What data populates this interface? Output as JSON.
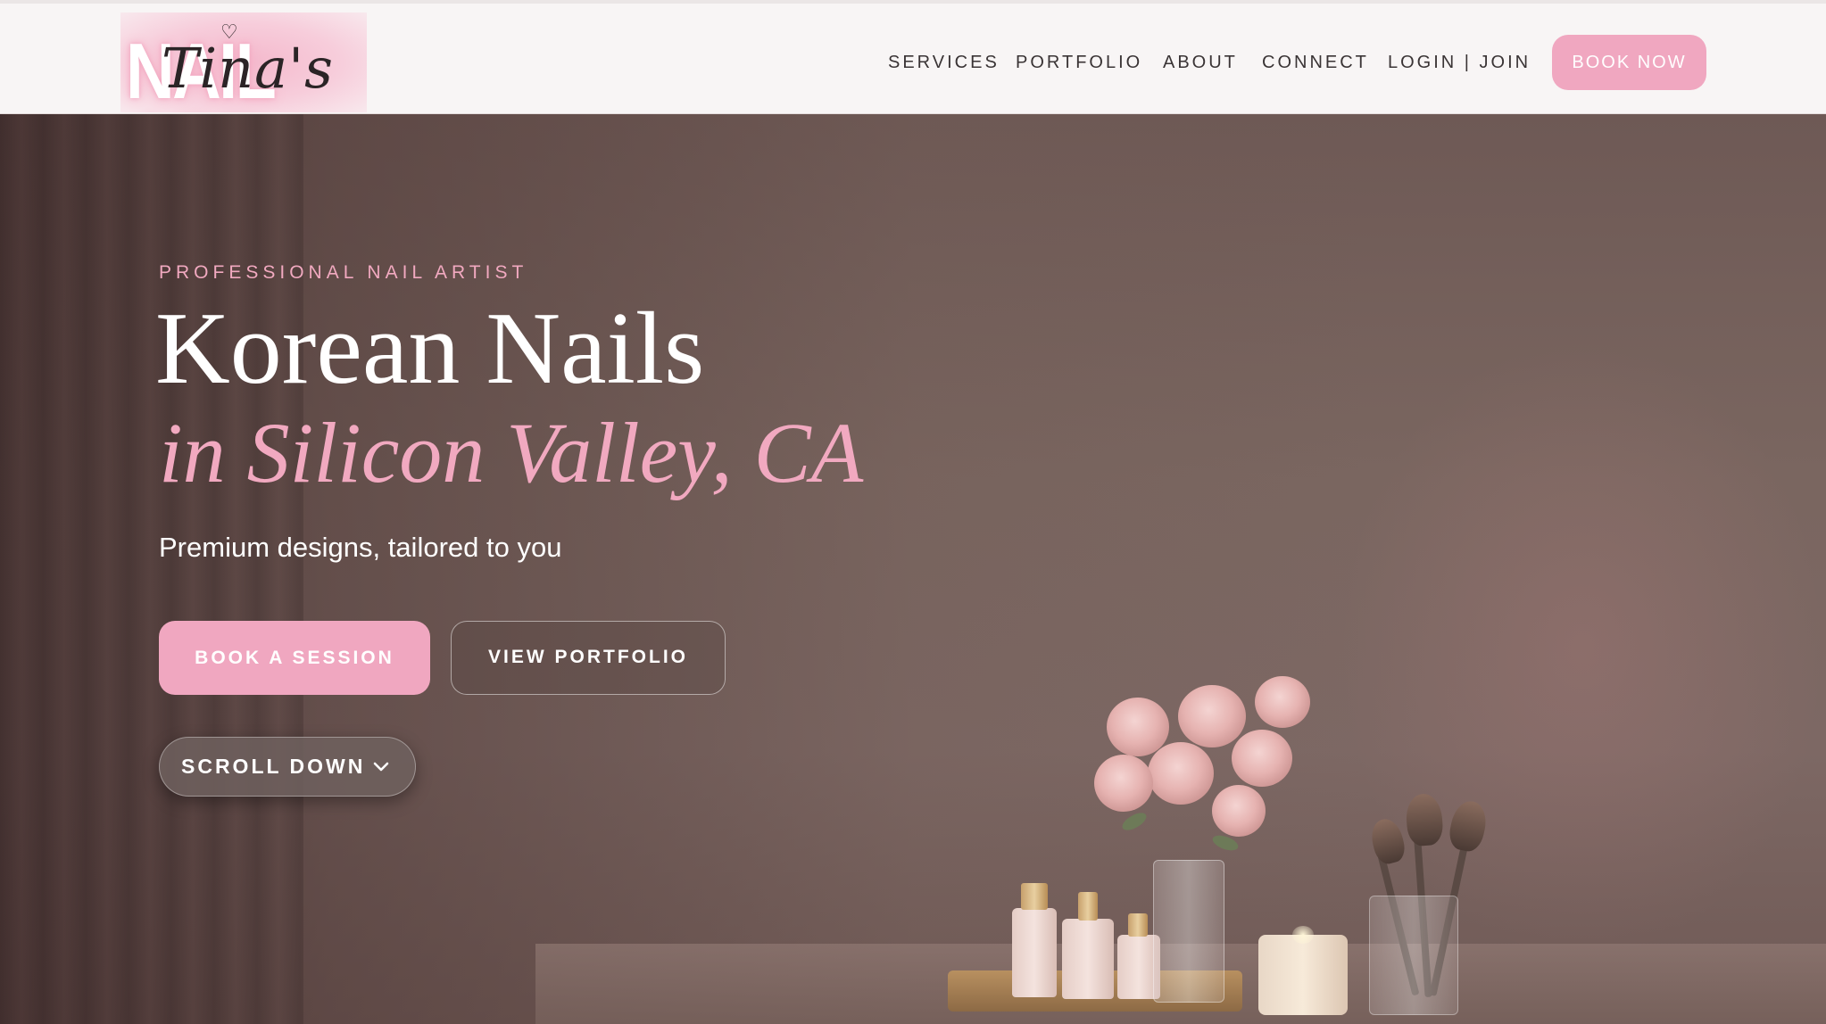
{
  "header": {
    "logo": {
      "block_text": "NAIL ART",
      "script_text": "Tina's",
      "heart": "♡"
    },
    "nav": {
      "services": "SERVICES",
      "portfolio": "PORTFOLIO",
      "about": "ABOUT",
      "connect": "CONNECT",
      "login_join": "LOGIN | JOIN"
    },
    "book_now": "BOOK NOW"
  },
  "hero": {
    "eyebrow": "PROFESSIONAL NAIL ARTIST",
    "title_line1": "Korean Nails",
    "title_line2": "in Silicon Valley, CA",
    "subtitle": "Premium designs, tailored to you",
    "book_session": "BOOK A SESSION",
    "view_portfolio": "VIEW PORTFOLIO",
    "scroll_down": "SCROLL DOWN",
    "scroll_icon": "chevron-down-icon"
  },
  "colors": {
    "accent_pink": "#f0a7c0",
    "header_bg": "#f8f5f5",
    "hero_bg": "#7a6660",
    "text_dark": "#3a3435"
  }
}
